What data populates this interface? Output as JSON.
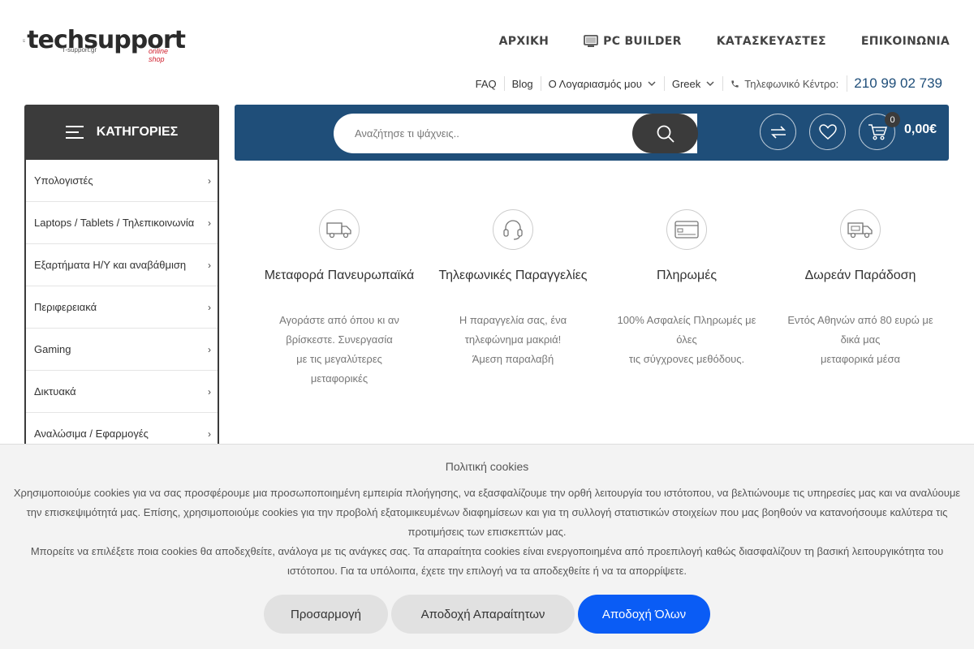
{
  "logo": {
    "brand_a": "tech",
    "brand_b": "support",
    "site": "T-support.gr",
    "tagline": "online shop"
  },
  "main_nav": [
    {
      "label": "ΑΡΧΙΚΗ",
      "icon": ""
    },
    {
      "label": "PC BUILDER",
      "icon": "monitor-icon"
    },
    {
      "label": "ΚΑΤΑΣΚΕΥΑΣΤΕΣ",
      "icon": ""
    },
    {
      "label": "ΕΠΙΚΟΙΝΩΝΙΑ",
      "icon": ""
    }
  ],
  "top_bar": {
    "faq": "FAQ",
    "blog": "Blog",
    "account": "Ο Λογαριασμός μου",
    "language": "Greek",
    "phone_label": "Τηλεφωνικό Κέντρο:",
    "phone_number": "210 99 02 739"
  },
  "categories": {
    "title": "ΚΑΤΗΓΟΡΙΕΣ",
    "items": [
      "Υπολογιστές",
      "Laptops / Tablets / Τηλεπικοινωνία",
      "Εξαρτήματα Η/Υ και αναβάθμιση",
      "Περιφερειακά",
      "Gaming",
      "Δικτυακά",
      "Αναλώσιμα / Εφαρμογές"
    ]
  },
  "search": {
    "placeholder": "Αναζήτησε τι ψάχνεις.."
  },
  "cart": {
    "count": "0",
    "total": "0,00€"
  },
  "features": [
    {
      "icon": "truck-icon",
      "title": "Μεταφορά Πανευρωπαϊκά",
      "desc": "Αγοράστε από όπου κι αν\nβρίσκεστε. Συνεργασία\nμε τις μεγαλύτερες\nμεταφορικές"
    },
    {
      "icon": "headset-icon",
      "title": "Τηλεφωνικές Παραγγελίες",
      "desc": "Η παραγγελία σας, ένα\nτηλεφώνημα μακριά!\nΆμεση παραλαβή"
    },
    {
      "icon": "credit-card-icon",
      "title": "Πληρωμές",
      "desc": "100% Ασφαλείς Πληρωμές με\nόλες\nτις σύγχρονες μεθόδους."
    },
    {
      "icon": "delivery-truck-icon",
      "title": "Δωρεάν Παράδοση",
      "desc": "Εντός Αθηνών από 80 ευρώ με\nδικά μας\nμεταφορικά μέσα"
    }
  ],
  "cookie": {
    "title": "Πολιτική cookies",
    "text1": "Χρησιμοποιούμε cookies για να σας προσφέρουμε μια προσωποποιημένη εμπειρία πλοήγησης, να εξασφαλίζουμε την ορθή λειτουργία του ιστότοπου, να βελτιώνουμε τις υπηρεσίες μας και να αναλύουμε την επισκεψιμότητά μας. Επίσης, χρησιμοποιούμε cookies για την προβολή εξατομικευμένων διαφημίσεων και για τη συλλογή στατιστικών στοιχείων που μας βοηθούν να κατανοήσουμε καλύτερα τις προτιμήσεις των επισκεπτών μας.",
    "text2": "Μπορείτε να επιλέξετε ποια cookies θα αποδεχθείτε, ανάλογα με τις ανάγκες σας. Τα απαραίτητα cookies είναι ενεργοποιημένα από προεπιλογή καθώς διασφαλίζουν τη βασική λειτουργικότητα του ιστότοπου. Για τα υπόλοιπα, έχετε την επιλογή να τα αποδεχθείτε ή να τα απορρίψετε.",
    "btn_customize": "Προσαρμογή",
    "btn_necessary": "Αποδοχή Απαραίτητων",
    "btn_all": "Αποδοχή Όλων"
  },
  "colors": {
    "primary_blue": "#1f4e79",
    "dark": "#3b3b3b",
    "accent_red": "#d0202e",
    "cookie_blue": "#0a5cf5"
  }
}
